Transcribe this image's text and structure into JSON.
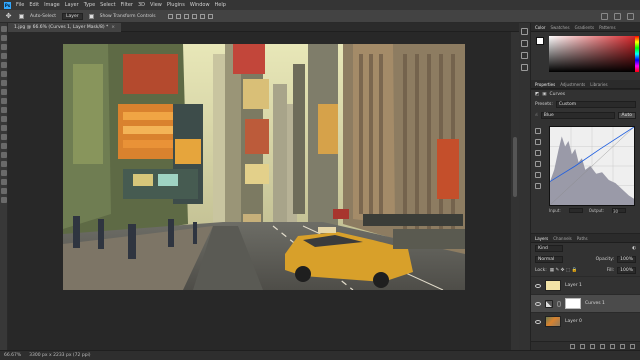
{
  "menu": {
    "logo": "Ps",
    "items": [
      "File",
      "Edit",
      "Image",
      "Layer",
      "Type",
      "Select",
      "Filter",
      "3D",
      "View",
      "Plugins",
      "Window",
      "Help"
    ]
  },
  "options": {
    "auto_select_label": "Auto-Select",
    "auto_select_target": "Layer",
    "show_transform_label": "Show Transform Controls"
  },
  "document": {
    "tab_title": "1.jpg @ 66.6% (Curves 1, Layer Mask/8) *",
    "zoom": "66.67%",
    "doc_info": "3300 px x 2233 px (72 ppi)"
  },
  "color_panel": {
    "tabs": [
      "Color",
      "Swatches",
      "Gradients",
      "Patterns"
    ],
    "foreground": "#ffffff",
    "background": "#111111"
  },
  "properties": {
    "tabs": [
      "Properties",
      "Adjustments",
      "Libraries"
    ],
    "title": "Curves",
    "preset_label": "Presets:",
    "preset_value": "Custom",
    "channel_value": "Blue",
    "auto_label": "Auto",
    "input_label": "Input:",
    "input_value": "",
    "output_label": "Output:",
    "output_value": "30"
  },
  "layers_panel": {
    "tabs": [
      "Layers",
      "Channels",
      "Paths"
    ],
    "kind_label": "Kind",
    "blend_mode": "Normal",
    "opacity_label": "Opacity:",
    "opacity_value": "100%",
    "lock_label": "Lock:",
    "fill_label": "Fill:",
    "fill_value": "100%",
    "layers": [
      {
        "name": "Layer 1",
        "type": "solid",
        "color": "#f2e2a6"
      },
      {
        "name": "Curves 1",
        "type": "adjustment"
      },
      {
        "name": "Layer 0",
        "type": "photo"
      }
    ]
  }
}
